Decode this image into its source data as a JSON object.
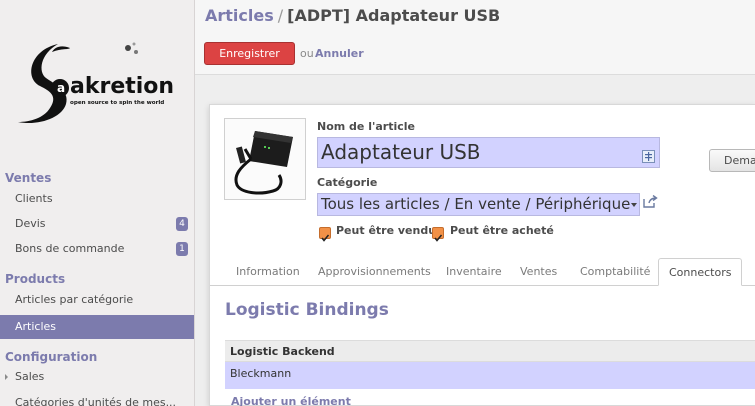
{
  "sidebar": {
    "logo_text": "akretion",
    "logo_tagline": "open source to spin the world",
    "sections": [
      {
        "title": "Ventes",
        "items": [
          {
            "label": "Clients",
            "badge": ""
          },
          {
            "label": "Devis",
            "badge": "4"
          },
          {
            "label": "Bons de commande",
            "badge": "1"
          }
        ]
      },
      {
        "title": "Products",
        "items": [
          {
            "label": "Articles par catégorie",
            "badge": ""
          },
          {
            "label": "Articles",
            "badge": "",
            "active": true
          }
        ]
      },
      {
        "title": "Configuration",
        "items": [
          {
            "label": "Sales",
            "badge": ""
          },
          {
            "label": "Catégories d'unités de mes...",
            "badge": ""
          }
        ]
      }
    ]
  },
  "header": {
    "breadcrumb_parent": "Articles",
    "breadcrumb_sep": "/",
    "breadcrumb_current": "[ADPT] Adaptateur USB",
    "save_label": "Enregistrer",
    "or_label": "ou",
    "cancel_label": "Annuler"
  },
  "form": {
    "name_label": "Nom de l'article",
    "name_value": "Adaptateur USB",
    "category_label": "Catégorie",
    "category_value": "Tous les articles / En vente / Périphérique",
    "can_be_sold_label": "Peut être vendu",
    "can_be_sold": true,
    "can_be_purchased_label": "Peut être acheté",
    "can_be_purchased": true,
    "side_button_label": "Demander"
  },
  "tabs": [
    {
      "label": "Information"
    },
    {
      "label": "Approvisionnements"
    },
    {
      "label": "Inventaire"
    },
    {
      "label": "Ventes"
    },
    {
      "label": "Comptabilité"
    },
    {
      "label": "Connectors",
      "active": true
    }
  ],
  "connectors": {
    "title": "Logistic Bindings",
    "column_header": "Logistic Backend",
    "rows": [
      "Bleckmann"
    ],
    "add_label": "Ajouter un élément"
  },
  "colors": {
    "brand": "#7c7bad",
    "save_button": "#dc4343",
    "required_field": "#d2d2ff",
    "checkbox": "#f29147"
  }
}
